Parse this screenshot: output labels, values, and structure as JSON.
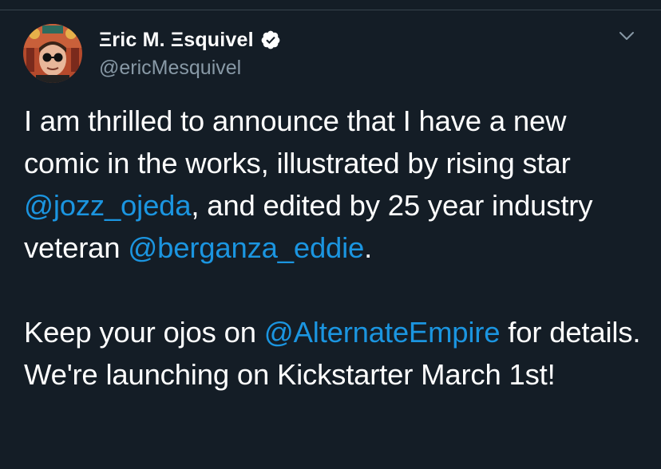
{
  "author": {
    "display_name": "Ξric M. Ξsquivel",
    "handle": "@ericMesquivel",
    "verified_icon": "verified-badge-icon",
    "avatar": "profile-avatar"
  },
  "menu": {
    "icon": "chevron-down-icon"
  },
  "tweet": {
    "p1_t1": "I am thrilled to announce that I have a new comic in the works, illustrated by rising star ",
    "p1_m1": "@jozz_ojeda",
    "p1_t2": ", and edited by 25 year industry veteran ",
    "p1_m2": "@berganza_eddie",
    "p1_t3": ".",
    "p2_t1": "Keep your ojos on ",
    "p2_m1": "@AlternateEmpire",
    "p2_t2": " for details. We're launching on Kickstarter March 1st!"
  },
  "colors": {
    "background": "#141d26",
    "text": "#ffffff",
    "secondary": "#8899a6",
    "link": "#1b95e0"
  }
}
